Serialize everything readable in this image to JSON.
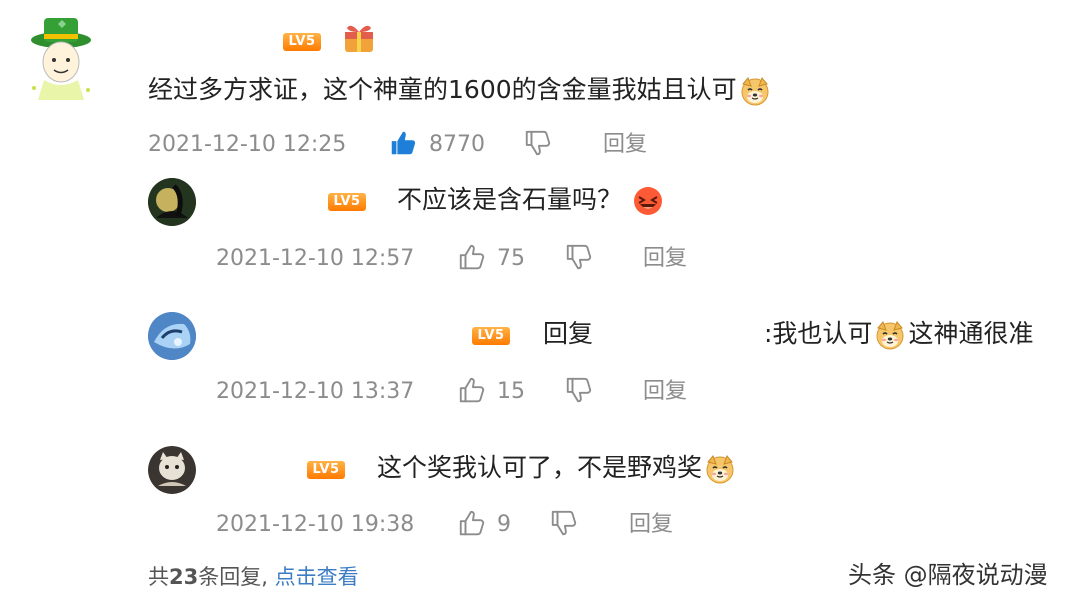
{
  "main_comment": {
    "level_badge": "LV5",
    "text": "经过多方求证，这个神童的1600的含金量我姑且认可",
    "time": "2021-12-10 12:25",
    "likes": "8770",
    "reply_label": "回复"
  },
  "replies": [
    {
      "level_badge": "LV5",
      "text": "不应该是含石量吗？",
      "time": "2021-12-10 12:57",
      "likes": "75",
      "reply_label": "回复"
    },
    {
      "level_badge": "LV5",
      "reply_word": "回复",
      "text_a": ":我也认可",
      "text_b": "这神通很准",
      "time": "2021-12-10 13:37",
      "likes": "15",
      "reply_label": "回复"
    },
    {
      "level_badge": "LV5",
      "text": "这个奖我认可了，不是野鸡奖",
      "time": "2021-12-10 19:38",
      "likes": "9",
      "reply_label": "回复"
    }
  ],
  "footer": {
    "prefix": "共",
    "count": "23",
    "suffix": "条回复,",
    "more_link": "点击查看"
  },
  "watermark": "头条 @隔夜说动漫",
  "colors": {
    "accent_blue": "#3b7cc4",
    "meta_gray": "#8c8c8c",
    "badge_orange": "#ff7a00"
  },
  "icons": {
    "like_filled": "thumbs-up-filled-icon",
    "like_outline": "thumbs-up-outline-icon",
    "dislike": "thumbs-down-icon",
    "dog_emoji": "doge-emoji-icon",
    "laugh_emoji": "laughing-face-emoji-icon",
    "gift": "gift-icon"
  }
}
